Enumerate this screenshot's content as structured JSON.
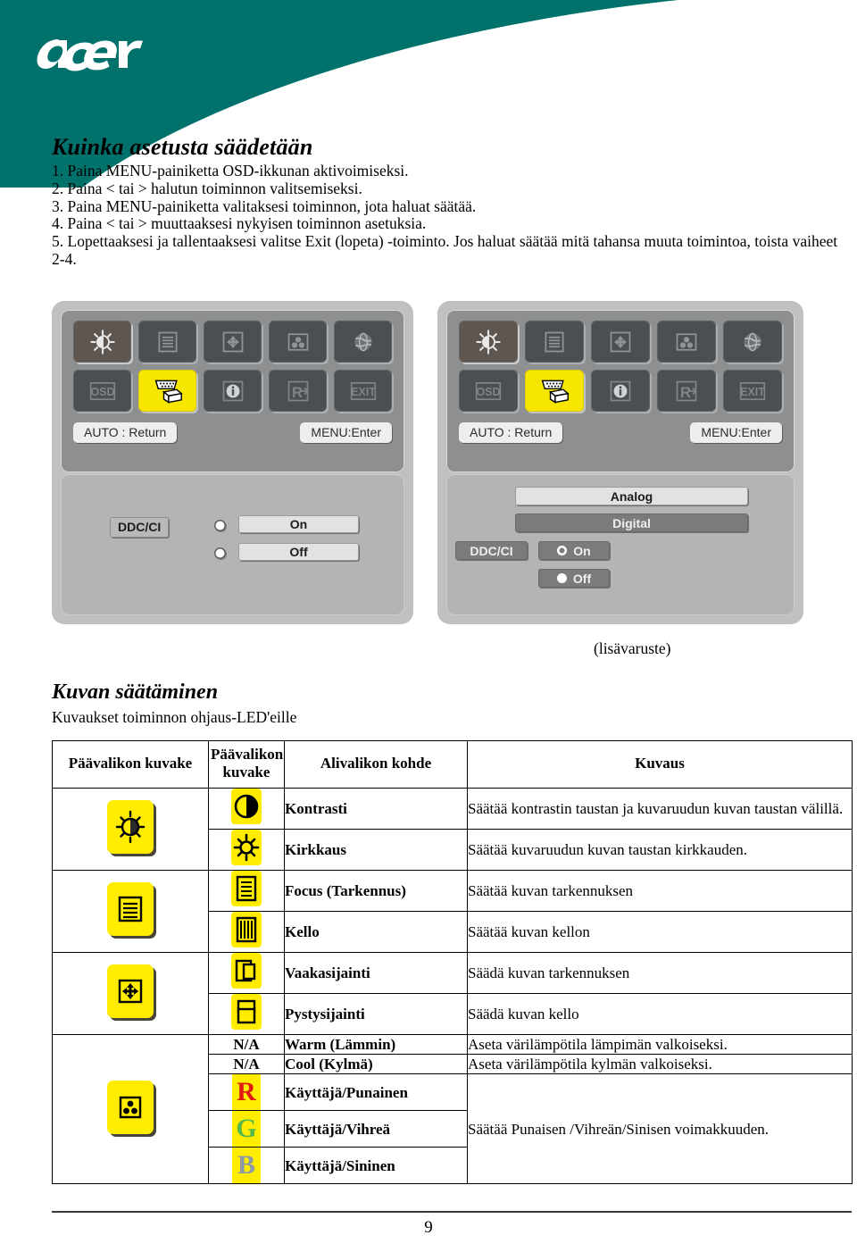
{
  "brand": {
    "logo_text": "acer",
    "teal_hex": "#00716b"
  },
  "howto": {
    "title": "Kuinka asetusta säädetään",
    "steps": [
      "1. Paina MENU-painiketta OSD-ikkunan aktivoimiseksi.",
      "2. Paina < tai > halutun toiminnon valitsemiseksi.",
      "3. Paina MENU-painiketta valitaksesi toiminnon, jota haluat säätää.",
      "4. Paina < tai > muuttaaksesi nykyisen toiminnon asetuksia.",
      "5. Lopettaaksesi ja tallentaaksesi valitse Exit (lopeta) -toiminto. Jos haluat säätää mitä tahansa muuta toimintoa, toista vaiheet 2-4."
    ]
  },
  "osd_left": {
    "icons": [
      {
        "name": "brightness-contrast-icon",
        "state": "selected"
      },
      {
        "name": "focus-clock-icon",
        "state": "normal"
      },
      {
        "name": "position-icon",
        "state": "normal"
      },
      {
        "name": "color-icon",
        "state": "normal"
      },
      {
        "name": "language-globe-icon",
        "state": "normal"
      },
      {
        "name": "osd-settings-icon",
        "state": "normal"
      },
      {
        "name": "input-source-icon",
        "state": "highlighted"
      },
      {
        "name": "information-icon",
        "state": "normal"
      },
      {
        "name": "reset-icon",
        "state": "normal"
      },
      {
        "name": "exit-icon",
        "state": "normal"
      }
    ],
    "key_left": "AUTO : Return",
    "key_right": "MENU:Enter",
    "ddc_label": "DDC/CI",
    "option_on": "On",
    "option_off": "Off"
  },
  "osd_right": {
    "icons": [
      {
        "name": "brightness-contrast-icon",
        "state": "selected"
      },
      {
        "name": "focus-clock-icon",
        "state": "normal"
      },
      {
        "name": "position-icon",
        "state": "normal"
      },
      {
        "name": "color-icon",
        "state": "normal"
      },
      {
        "name": "language-globe-icon",
        "state": "normal"
      },
      {
        "name": "osd-settings-icon",
        "state": "normal"
      },
      {
        "name": "input-source-icon",
        "state": "highlighted"
      },
      {
        "name": "information-icon",
        "state": "normal"
      },
      {
        "name": "reset-icon",
        "state": "normal"
      },
      {
        "name": "exit-icon",
        "state": "normal"
      }
    ],
    "key_left": "AUTO : Return",
    "key_right": "MENU:Enter",
    "analog": "Analog",
    "digital": "Digital",
    "ddc_label": "DDC/CI",
    "option_on": "On",
    "option_off": "Off"
  },
  "optional_note": "(lisävaruste)",
  "section": {
    "title": "Kuvan säätäminen",
    "subtitle": "Kuvaukset toiminnon ohjaus-LED'eille"
  },
  "table": {
    "headers": [
      "Päävalikon kuvake",
      "Päävalikon kuvake",
      "Alivalikon kohde",
      "Kuvaus"
    ],
    "groups": [
      {
        "main_icon": "brightness-contrast-tile-icon",
        "rows": [
          {
            "sub_icon": "contrast-icon",
            "item": "Kontrasti",
            "desc": "Säätää kontrastin taustan ja kuvaruudun kuvan taustan välillä."
          },
          {
            "sub_icon": "brightness-icon",
            "item": "Kirkkaus",
            "desc": "Säätää kuvaruudun kuvan taustan kirkkauden."
          }
        ]
      },
      {
        "main_icon": "focus-clock-tile-icon",
        "rows": [
          {
            "sub_icon": "focus-icon",
            "item": "Focus (Tarkennus)",
            "desc": "Säätää kuvan tarkennuksen"
          },
          {
            "sub_icon": "clock-icon",
            "item": "Kello",
            "desc": "Säätää kuvan kellon"
          }
        ]
      },
      {
        "main_icon": "position-tile-icon",
        "rows": [
          {
            "sub_icon": "h-position-icon",
            "item": "Vaakasijainti",
            "desc": "Säädä kuvan tarkennuksen"
          },
          {
            "sub_icon": "v-position-icon",
            "item": "Pystysijainti",
            "desc": "Säädä kuvan kello"
          }
        ]
      },
      {
        "main_icon": "color-tile-icon",
        "rows": [
          {
            "sub_icon": "na-text",
            "sub_text": "N/A",
            "item": "Warm (Lämmin)",
            "desc": "Aseta värilämpötila lämpimän valkoiseksi."
          },
          {
            "sub_icon": "na-text",
            "sub_text": "N/A",
            "item": "Cool (Kylmä)",
            "desc": "Aseta värilämpötila kylmän valkoiseksi."
          },
          {
            "sub_icon": "red-letter-icon",
            "sub_text": "R",
            "item": "Käyttäjä/Punainen",
            "desc": "Säätää Punaisen /Vihreän/Sinisen voimakkuuden."
          },
          {
            "sub_icon": "green-letter-icon",
            "sub_text": "G",
            "item": "Käyttäjä/Vihreä",
            "desc": ""
          },
          {
            "sub_icon": "blue-letter-icon",
            "sub_text": "B",
            "item": "Käyttäjä/Sininen",
            "desc": ""
          }
        ]
      }
    ]
  },
  "footer": {
    "page_number": "9"
  }
}
